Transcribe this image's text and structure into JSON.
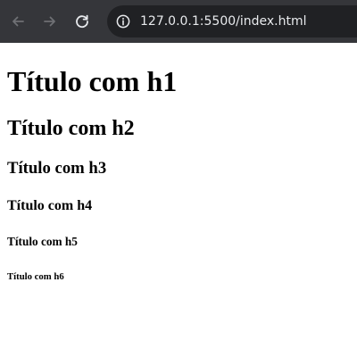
{
  "browser": {
    "url": "127.0.0.1:5500/index.html",
    "icons": {
      "back": "arrow-left",
      "forward": "arrow-right",
      "reload": "reload",
      "site_info": "info-circle"
    },
    "colors": {
      "toolbar": "#35363a",
      "address_bar": "#202124",
      "url_text": "#e8eaed",
      "disabled_icon": "#6f7074",
      "active_icon": "#e8eaed"
    }
  },
  "page": {
    "background": "#ffffff",
    "headings": {
      "h1": "Título com h1",
      "h2": "Título com h2",
      "h3": "Título com h3",
      "h4": "Título com h4",
      "h5": "Título com h5",
      "h6": "Título com h6"
    }
  }
}
